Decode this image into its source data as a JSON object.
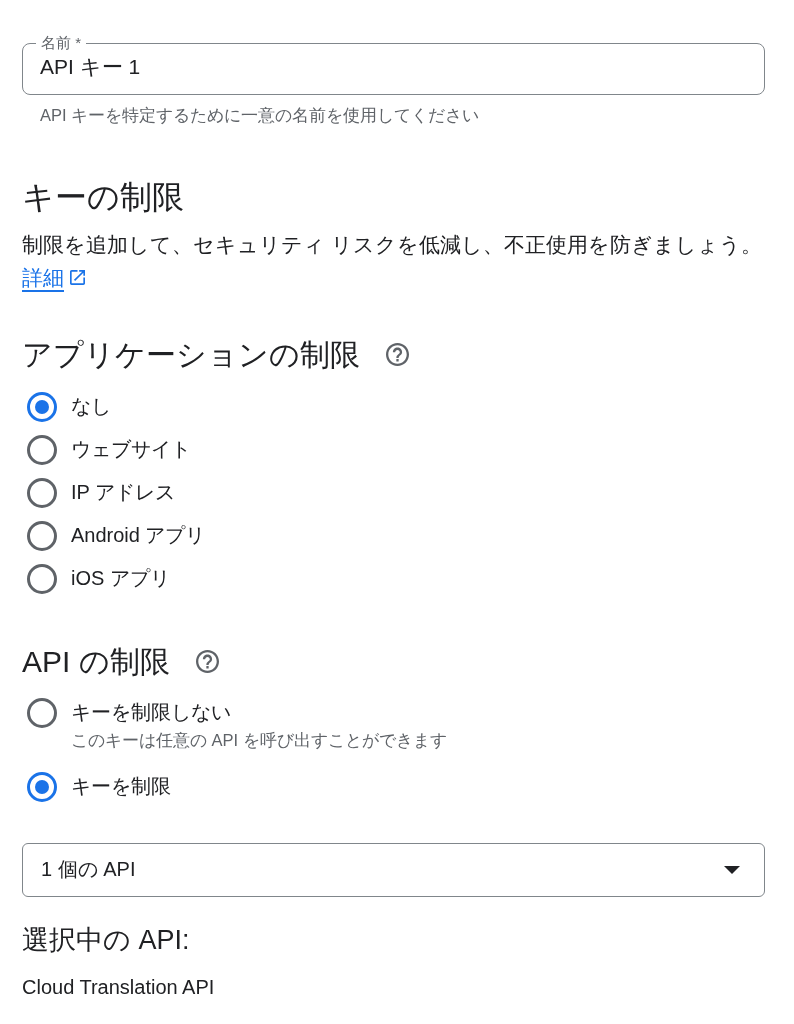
{
  "name_field": {
    "label": "名前 *",
    "value": "API キー 1",
    "helper": "API キーを特定するために一意の名前を使用してください"
  },
  "key_restrictions": {
    "title": "キーの制限",
    "description": "制限を追加して、セキュリティ リスクを低減し、不正使用を防ぎましょう。",
    "link": "詳細"
  },
  "application_restrictions": {
    "title": "アプリケーションの制限",
    "options": [
      {
        "label": "なし",
        "selected": true
      },
      {
        "label": "ウェブサイト",
        "selected": false
      },
      {
        "label": "IP アドレス",
        "selected": false
      },
      {
        "label": "Android アプリ",
        "selected": false
      },
      {
        "label": "iOS アプリ",
        "selected": false
      }
    ]
  },
  "api_restrictions": {
    "title": "API の制限",
    "options": [
      {
        "label": "キーを制限しない",
        "description": "このキーは任意の API を呼び出すことができます",
        "selected": false
      },
      {
        "label": "キーを制限",
        "selected": true
      }
    ]
  },
  "api_select": {
    "value": "1 個の API"
  },
  "selected_apis": {
    "title": "選択中の API:",
    "items": [
      "Cloud Translation API"
    ]
  }
}
